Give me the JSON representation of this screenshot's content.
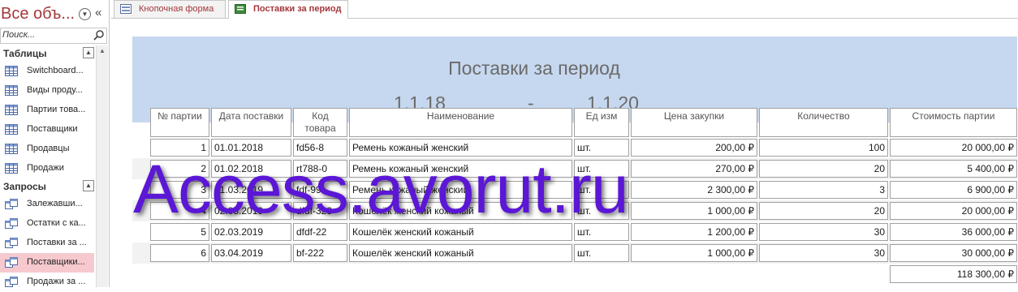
{
  "nav": {
    "title": "Все объ...",
    "search_placeholder": "Поиск...",
    "groups": [
      {
        "label": "Таблицы",
        "items": [
          "Switchboard...",
          "Виды проду...",
          "Партии това...",
          "Поставщики",
          "Продавцы",
          "Продажи"
        ]
      },
      {
        "label": "Запросы",
        "items": [
          "Залежавши...",
          "Остатки с ка...",
          "Поставки за ...",
          "Поставщики...",
          "Продажи за ..."
        ]
      }
    ],
    "selected_item": "Поставщики..."
  },
  "tabs": [
    {
      "label": "Кнопочная форма",
      "active": false
    },
    {
      "label": "Поставки за период",
      "active": true
    }
  ],
  "report": {
    "title": "Поставки за период",
    "date_from": "1.1.18",
    "dash": "-",
    "date_to": "1.1.20",
    "columns": [
      "№ партии",
      "Дата поставки",
      "Код товара",
      "Наименование",
      "Ед изм",
      "Цена закупки",
      "Количество",
      "Стоимость партии"
    ],
    "rows": [
      [
        "1",
        "01.01.2018",
        "fd56-8",
        "Ремень кожаный женский",
        "шт.",
        "200,00 ₽",
        "100",
        "20 000,00 ₽"
      ],
      [
        "2",
        "01.02.2018",
        "rt788-0",
        "Ремень кожаный женский",
        "шт.",
        "270,00 ₽",
        "20",
        "5 400,00 ₽"
      ],
      [
        "3",
        "01.03.2019",
        "fdf-99",
        "Ремень кожаный женский",
        "шт.",
        "2 300,00 ₽",
        "3",
        "6 900,00 ₽"
      ],
      [
        "4",
        "02.03.2019",
        "dfdf-323",
        "Кошелёк женский кожаный",
        "шт.",
        "1 000,00 ₽",
        "20",
        "20 000,00 ₽"
      ],
      [
        "5",
        "02.03.2019",
        "dfdf-22",
        "Кошелёк женский кожаный",
        "шт.",
        "1 200,00 ₽",
        "30",
        "36 000,00 ₽"
      ],
      [
        "6",
        "03.04.2019",
        "bf-222",
        "Кошелёк женский кожаный",
        "шт.",
        "1 000,00 ₽",
        "30",
        "30 000,00 ₽"
      ]
    ],
    "total": "118 300,00 ₽"
  },
  "watermark": "Access.avorut.ru"
}
